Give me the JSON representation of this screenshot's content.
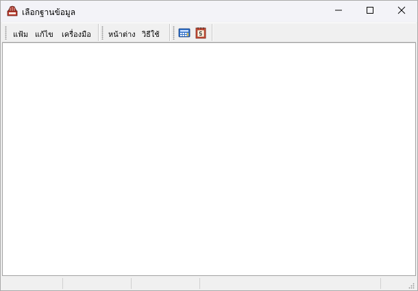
{
  "window": {
    "title": "เลือกฐานข้อมูล",
    "app_icon": "database-books-icon",
    "controls": [
      "minimize-icon",
      "maximize-icon",
      "close-icon"
    ]
  },
  "menu": {
    "items": [
      {
        "label": "แฟ้ม"
      },
      {
        "label": "แก้ไข"
      },
      {
        "label": "เครื่องมือ"
      },
      {
        "label": "หน้าต่าง"
      },
      {
        "label": "วิธีใช้"
      }
    ]
  },
  "toolbar": {
    "buttons": [
      {
        "icon": "calculator-icon"
      },
      {
        "icon": "calendar-icon"
      }
    ]
  },
  "colors": {
    "titlebar": "#f3f3f8",
    "chrome": "#f0f0f0",
    "client": "#ffffff"
  }
}
